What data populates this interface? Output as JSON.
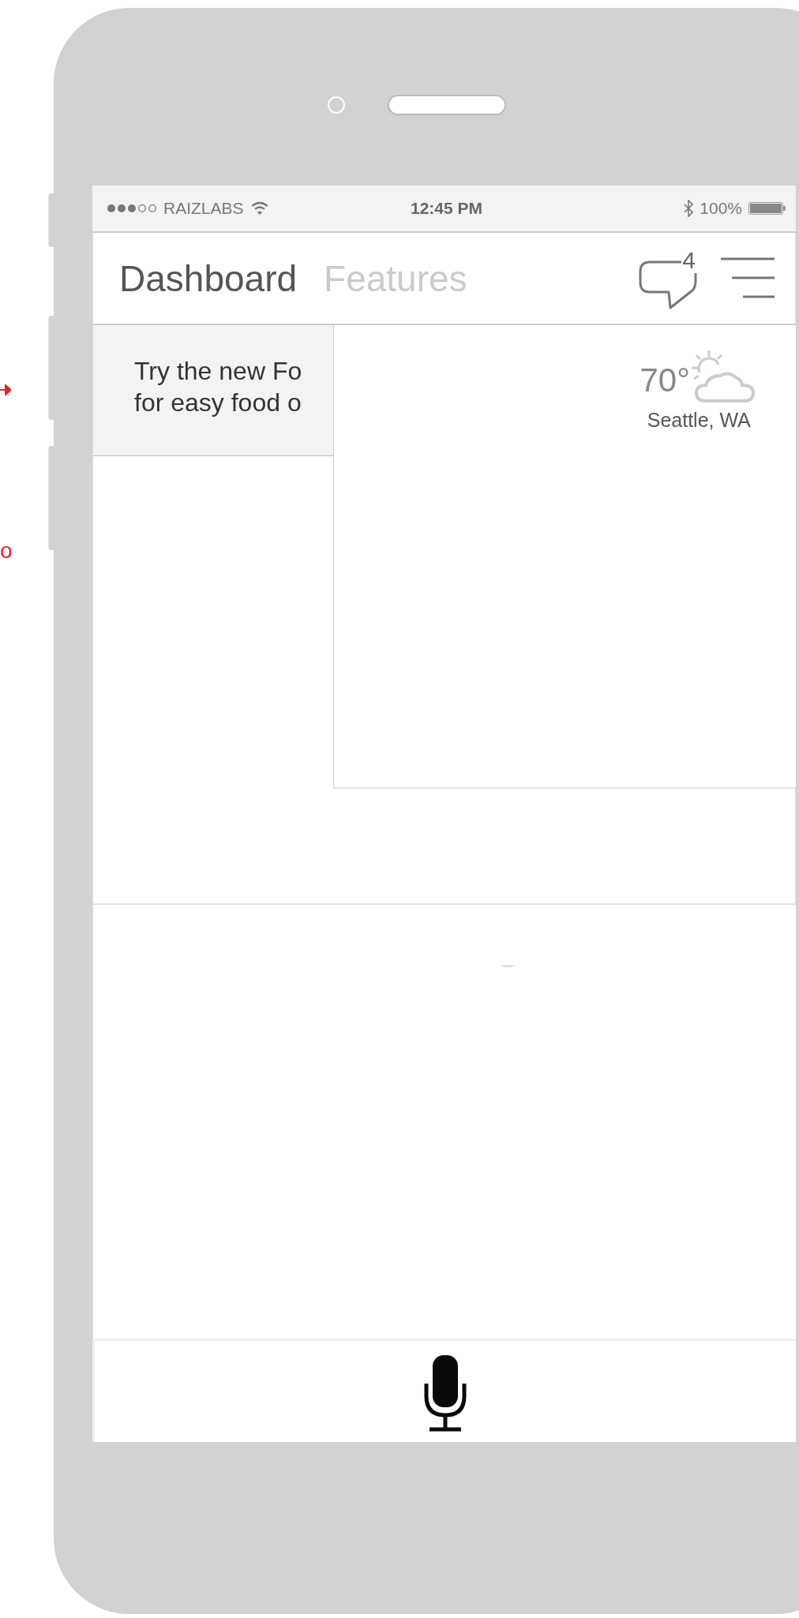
{
  "annotation": {
    "text": "o"
  },
  "status_bar": {
    "carrier": "RAIZLABS",
    "time": "12:45 PM",
    "battery": "100%"
  },
  "header": {
    "tabs": [
      {
        "label": "Dashboard",
        "selected": true
      },
      {
        "label": "Features",
        "selected": false
      }
    ],
    "messages_badge": "4"
  },
  "banner": {
    "lines": [
      "Try the new Fo",
      "for easy food o"
    ]
  },
  "weather": {
    "temperature": "70°",
    "location": "Seattle, WA"
  }
}
